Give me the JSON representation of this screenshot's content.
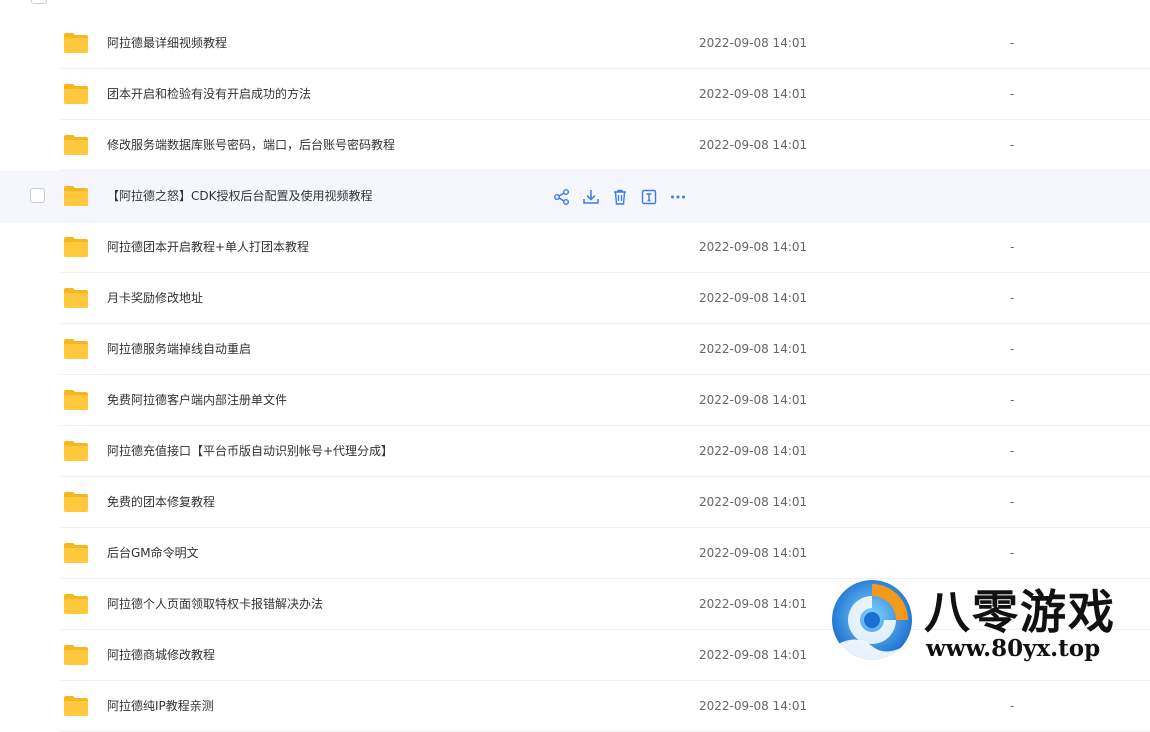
{
  "files": [
    {
      "name": "阿拉德最详细视频教程",
      "date": "2022-09-08 14:01",
      "size": "-"
    },
    {
      "name": "团本开启和检验有没有开启成功的方法",
      "date": "2022-09-08 14:01",
      "size": "-"
    },
    {
      "name": "修改服务端数据库账号密码，端口，后台账号密码教程",
      "date": "2022-09-08 14:01",
      "size": "-"
    },
    {
      "name": "【阿拉德之怒】CDK授权后台配置及使用视频教程",
      "date": "",
      "size": ""
    },
    {
      "name": "阿拉德团本开启教程+单人打团本教程",
      "date": "2022-09-08 14:01",
      "size": "-"
    },
    {
      "name": "月卡奖励修改地址",
      "date": "2022-09-08 14:01",
      "size": "-"
    },
    {
      "name": "阿拉德服务端掉线自动重启",
      "date": "2022-09-08 14:01",
      "size": "-"
    },
    {
      "name": "免费阿拉德客户端内部注册单文件",
      "date": "2022-09-08 14:01",
      "size": "-"
    },
    {
      "name": "阿拉德充值接口【平台币版自动识别帐号+代理分成】",
      "date": "2022-09-08 14:01",
      "size": "-"
    },
    {
      "name": "免费的团本修复教程",
      "date": "2022-09-08 14:01",
      "size": "-"
    },
    {
      "name": "后台GM命令明文",
      "date": "2022-09-08 14:01",
      "size": "-"
    },
    {
      "name": "阿拉德个人页面领取特权卡报错解决办法",
      "date": "2022-09-08 14:01",
      "size": "-"
    },
    {
      "name": "阿拉德商城修改教程",
      "date": "2022-09-08 14:01",
      "size": "-"
    },
    {
      "name": "阿拉德纯IP教程亲测",
      "date": "2022-09-08 14:01",
      "size": "-"
    }
  ],
  "hover_index": 3,
  "hover_actions": [
    {
      "icon": "share-icon"
    },
    {
      "icon": "download-icon"
    },
    {
      "icon": "delete-icon"
    },
    {
      "icon": "rename-icon"
    },
    {
      "icon": "more-icon"
    }
  ],
  "colors": {
    "folder": "#ffc83d",
    "action": "#3a7af2",
    "hover_bg": "#f5f7fc"
  },
  "watermark": {
    "title": "八零游戏",
    "url": "www.80yx.top"
  }
}
